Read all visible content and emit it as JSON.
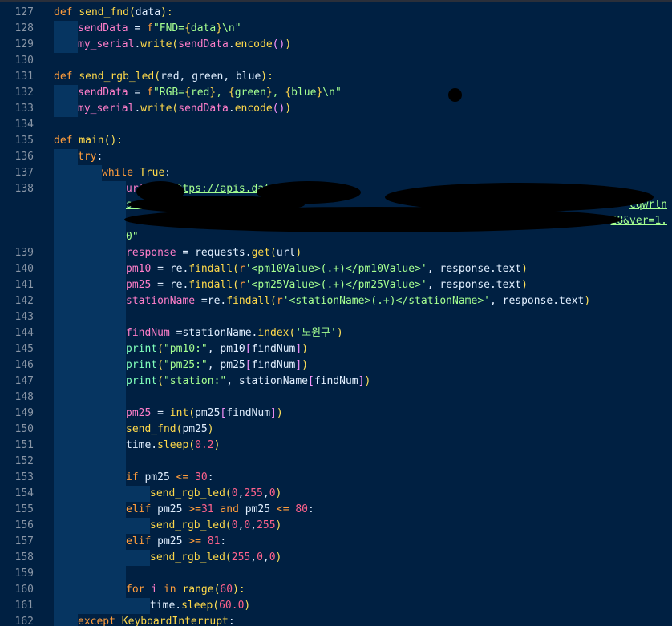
{
  "editor": {
    "lines": [
      {
        "n": "127",
        "indent": 0,
        "tokens": [
          [
            "kw",
            "def "
          ],
          [
            "fn",
            "send_fnd"
          ],
          [
            "paren",
            "("
          ],
          [
            "plain",
            "data"
          ],
          [
            "paren",
            "):"
          ]
        ]
      },
      {
        "n": "128",
        "indent": 1,
        "tokens": [
          [
            "var",
            "sendData"
          ],
          [
            "plain",
            " = "
          ],
          [
            "kw",
            "f"
          ],
          [
            "str",
            "\"FND="
          ],
          [
            "brace",
            "{"
          ],
          [
            "str",
            "data"
          ],
          [
            "brace",
            "}"
          ],
          [
            "str",
            "\\n\""
          ]
        ]
      },
      {
        "n": "129",
        "indent": 1,
        "tokens": [
          [
            "var",
            "my_serial"
          ],
          [
            "plain",
            "."
          ],
          [
            "fn",
            "write"
          ],
          [
            "paren",
            "("
          ],
          [
            "var",
            "sendData"
          ],
          [
            "plain",
            "."
          ],
          [
            "fn",
            "encode"
          ],
          [
            "bracket",
            "()"
          ],
          [
            "paren",
            ")"
          ]
        ]
      },
      {
        "n": "130",
        "indent": 0,
        "tokens": []
      },
      {
        "n": "131",
        "indent": 0,
        "tokens": [
          [
            "kw",
            "def "
          ],
          [
            "fn",
            "send_rgb_led"
          ],
          [
            "paren",
            "("
          ],
          [
            "plain",
            "red, green, blue"
          ],
          [
            "paren",
            "):"
          ]
        ]
      },
      {
        "n": "132",
        "indent": 1,
        "tokens": [
          [
            "var",
            "sendData"
          ],
          [
            "plain",
            " = "
          ],
          [
            "kw",
            "f"
          ],
          [
            "str",
            "\"RGB="
          ],
          [
            "brace",
            "{"
          ],
          [
            "str",
            "red"
          ],
          [
            "brace",
            "}"
          ],
          [
            "str",
            ", "
          ],
          [
            "brace",
            "{"
          ],
          [
            "str",
            "green"
          ],
          [
            "brace",
            "}"
          ],
          [
            "str",
            ", "
          ],
          [
            "brace",
            "{"
          ],
          [
            "str",
            "blue"
          ],
          [
            "brace",
            "}"
          ],
          [
            "str",
            "\\n\""
          ]
        ]
      },
      {
        "n": "133",
        "indent": 1,
        "tokens": [
          [
            "var",
            "my_serial"
          ],
          [
            "plain",
            "."
          ],
          [
            "fn",
            "write"
          ],
          [
            "paren",
            "("
          ],
          [
            "var",
            "sendData"
          ],
          [
            "plain",
            "."
          ],
          [
            "fn",
            "encode"
          ],
          [
            "bracket",
            "()"
          ],
          [
            "paren",
            ")"
          ]
        ]
      },
      {
        "n": "134",
        "indent": 0,
        "tokens": []
      },
      {
        "n": "135",
        "indent": 0,
        "tokens": [
          [
            "kw",
            "def "
          ],
          [
            "fn",
            "main"
          ],
          [
            "paren",
            "():"
          ]
        ]
      },
      {
        "n": "136",
        "indent": 1,
        "tokens": [
          [
            "kw",
            "try"
          ],
          [
            "plain",
            ":"
          ]
        ]
      },
      {
        "n": "137",
        "indent": 2,
        "tokens": [
          [
            "kw",
            "while "
          ],
          [
            "fn",
            "True"
          ],
          [
            "plain",
            ":"
          ]
        ]
      },
      {
        "n": "138",
        "indent": 3,
        "tokens": [
          [
            "var",
            "url"
          ],
          [
            "plain",
            " = "
          ],
          [
            "str",
            "\"h"
          ],
          [
            "url",
            "ttps://apis.dat"
          ]
        ]
      },
      {
        "n": "",
        "indent": 3,
        "tokens": [
          [
            "url",
            "servi"
          ]
        ],
        "tail": [
          [
            "url",
            "cqwrln"
          ]
        ]
      },
      {
        "n": "",
        "indent": 3,
        "tokens": [],
        "tail": [
          [
            "url",
            "28&ver=1."
          ]
        ]
      },
      {
        "n": "",
        "indent": 3,
        "tokens": [
          [
            "str",
            "0\""
          ]
        ]
      },
      {
        "n": "139",
        "indent": 3,
        "tokens": [
          [
            "var",
            "response"
          ],
          [
            "plain",
            " = "
          ],
          [
            "plain",
            "requests."
          ],
          [
            "fn",
            "get"
          ],
          [
            "paren",
            "("
          ],
          [
            "plain",
            "url"
          ],
          [
            "paren",
            ")"
          ]
        ]
      },
      {
        "n": "140",
        "indent": 3,
        "tokens": [
          [
            "var",
            "pm10"
          ],
          [
            "plain",
            " = re."
          ],
          [
            "fn",
            "findall"
          ],
          [
            "paren",
            "("
          ],
          [
            "kw",
            "r"
          ],
          [
            "str",
            "'<pm10Value>(.+)</pm10Value>'"
          ],
          [
            "plain",
            ", response.text"
          ],
          [
            "paren",
            ")"
          ]
        ]
      },
      {
        "n": "141",
        "indent": 3,
        "tokens": [
          [
            "var",
            "pm25"
          ],
          [
            "plain",
            " = re."
          ],
          [
            "fn",
            "findall"
          ],
          [
            "paren",
            "("
          ],
          [
            "kw",
            "r"
          ],
          [
            "str",
            "'<pm25Value>(.+)</pm25Value>'"
          ],
          [
            "plain",
            ", response.text"
          ],
          [
            "paren",
            ")"
          ]
        ]
      },
      {
        "n": "142",
        "indent": 3,
        "tokens": [
          [
            "var",
            "stationName"
          ],
          [
            "plain",
            " =re."
          ],
          [
            "fn",
            "findall"
          ],
          [
            "paren",
            "("
          ],
          [
            "kw",
            "r"
          ],
          [
            "str",
            "'<stationName>(.+)</stationName>'"
          ],
          [
            "plain",
            ", response.text"
          ],
          [
            "paren",
            ")"
          ]
        ]
      },
      {
        "n": "143",
        "indent": 3,
        "tokens": []
      },
      {
        "n": "144",
        "indent": 3,
        "tokens": [
          [
            "var",
            "findNum"
          ],
          [
            "plain",
            " =stationName."
          ],
          [
            "fn",
            "index"
          ],
          [
            "paren",
            "("
          ],
          [
            "str",
            "'노원구'"
          ],
          [
            "paren",
            ")"
          ]
        ]
      },
      {
        "n": "145",
        "indent": 3,
        "tokens": [
          [
            "builtin",
            "print"
          ],
          [
            "paren",
            "("
          ],
          [
            "str",
            "\"pm10:\""
          ],
          [
            "plain",
            ", pm10"
          ],
          [
            "bracket",
            "["
          ],
          [
            "plain",
            "findNum"
          ],
          [
            "bracket",
            "]"
          ],
          [
            "paren",
            ")"
          ]
        ]
      },
      {
        "n": "146",
        "indent": 3,
        "tokens": [
          [
            "builtin",
            "print"
          ],
          [
            "paren",
            "("
          ],
          [
            "str",
            "\"pm25:\""
          ],
          [
            "plain",
            ", pm25"
          ],
          [
            "bracket",
            "["
          ],
          [
            "plain",
            "findNum"
          ],
          [
            "bracket",
            "]"
          ],
          [
            "paren",
            ")"
          ]
        ]
      },
      {
        "n": "147",
        "indent": 3,
        "tokens": [
          [
            "builtin",
            "print"
          ],
          [
            "paren",
            "("
          ],
          [
            "str",
            "\"station:\""
          ],
          [
            "plain",
            ", stationName"
          ],
          [
            "bracket",
            "["
          ],
          [
            "plain",
            "findNum"
          ],
          [
            "bracket",
            "]"
          ],
          [
            "paren",
            ")"
          ]
        ]
      },
      {
        "n": "148",
        "indent": 3,
        "tokens": []
      },
      {
        "n": "149",
        "indent": 3,
        "tokens": [
          [
            "var",
            "pm25"
          ],
          [
            "plain",
            " = "
          ],
          [
            "fn",
            "int"
          ],
          [
            "paren",
            "("
          ],
          [
            "plain",
            "pm25"
          ],
          [
            "bracket",
            "["
          ],
          [
            "plain",
            "findNum"
          ],
          [
            "bracket",
            "]"
          ],
          [
            "paren",
            ")"
          ]
        ]
      },
      {
        "n": "150",
        "indent": 3,
        "tokens": [
          [
            "fn",
            "send_fnd"
          ],
          [
            "paren",
            "("
          ],
          [
            "plain",
            "pm25"
          ],
          [
            "paren",
            ")"
          ]
        ]
      },
      {
        "n": "151",
        "indent": 3,
        "tokens": [
          [
            "plain",
            "time."
          ],
          [
            "fn",
            "sleep"
          ],
          [
            "paren",
            "("
          ],
          [
            "num",
            "0.2"
          ],
          [
            "paren",
            ")"
          ]
        ]
      },
      {
        "n": "152",
        "indent": 3,
        "tokens": []
      },
      {
        "n": "153",
        "indent": 3,
        "tokens": [
          [
            "kw",
            "if "
          ],
          [
            "plain",
            "pm25 "
          ],
          [
            "op",
            "<="
          ],
          [
            "plain",
            " "
          ],
          [
            "num",
            "30"
          ],
          [
            "plain",
            ":"
          ]
        ]
      },
      {
        "n": "154",
        "indent": 4,
        "tokens": [
          [
            "fn",
            "send_rgb_led"
          ],
          [
            "paren",
            "("
          ],
          [
            "num",
            "0"
          ],
          [
            "plain",
            ","
          ],
          [
            "num",
            "255"
          ],
          [
            "plain",
            ","
          ],
          [
            "num",
            "0"
          ],
          [
            "paren",
            ")"
          ]
        ]
      },
      {
        "n": "155",
        "indent": 3,
        "tokens": [
          [
            "kw",
            "elif "
          ],
          [
            "plain",
            "pm25 "
          ],
          [
            "op",
            ">="
          ],
          [
            "num",
            "31"
          ],
          [
            "plain",
            " "
          ],
          [
            "kw",
            "and"
          ],
          [
            "plain",
            " pm25 "
          ],
          [
            "op",
            "<="
          ],
          [
            "plain",
            " "
          ],
          [
            "num",
            "80"
          ],
          [
            "plain",
            ":"
          ]
        ]
      },
      {
        "n": "156",
        "indent": 4,
        "tokens": [
          [
            "fn",
            "send_rgb_led"
          ],
          [
            "paren",
            "("
          ],
          [
            "num",
            "0"
          ],
          [
            "plain",
            ","
          ],
          [
            "num",
            "0"
          ],
          [
            "plain",
            ","
          ],
          [
            "num",
            "255"
          ],
          [
            "paren",
            ")"
          ]
        ]
      },
      {
        "n": "157",
        "indent": 3,
        "tokens": [
          [
            "kw",
            "elif "
          ],
          [
            "plain",
            "pm25 "
          ],
          [
            "op",
            ">="
          ],
          [
            "plain",
            " "
          ],
          [
            "num",
            "81"
          ],
          [
            "plain",
            ":"
          ]
        ]
      },
      {
        "n": "158",
        "indent": 4,
        "tokens": [
          [
            "fn",
            "send_rgb_led"
          ],
          [
            "paren",
            "("
          ],
          [
            "num",
            "255"
          ],
          [
            "plain",
            ","
          ],
          [
            "num",
            "0"
          ],
          [
            "plain",
            ","
          ],
          [
            "num",
            "0"
          ],
          [
            "paren",
            ")"
          ]
        ]
      },
      {
        "n": "159",
        "indent": 3,
        "tokens": []
      },
      {
        "n": "160",
        "indent": 3,
        "tokens": [
          [
            "kw",
            "for "
          ],
          [
            "var",
            "i"
          ],
          [
            "kw",
            " in "
          ],
          [
            "fn",
            "range"
          ],
          [
            "paren",
            "("
          ],
          [
            "num",
            "60"
          ],
          [
            "paren",
            "):"
          ]
        ]
      },
      {
        "n": "161",
        "indent": 4,
        "tokens": [
          [
            "plain",
            "time."
          ],
          [
            "fn",
            "sleep"
          ],
          [
            "paren",
            "("
          ],
          [
            "num",
            "60.0"
          ],
          [
            "paren",
            ")"
          ]
        ]
      },
      {
        "n": "162",
        "indent": 1,
        "tokens": [
          [
            "kw",
            "except "
          ],
          [
            "fn",
            "KeyboardInterrupt"
          ],
          [
            "plain",
            ":"
          ]
        ]
      }
    ]
  },
  "colors": {
    "background": "#002042",
    "indent_guide": "#063561",
    "line_number": "#8a96a6",
    "keyword": "#ff9d3c",
    "function": "#ffd94a",
    "string": "#a5ff90",
    "number": "#ff628c",
    "variable": "#ff7ec9",
    "plain": "#e1efff"
  }
}
